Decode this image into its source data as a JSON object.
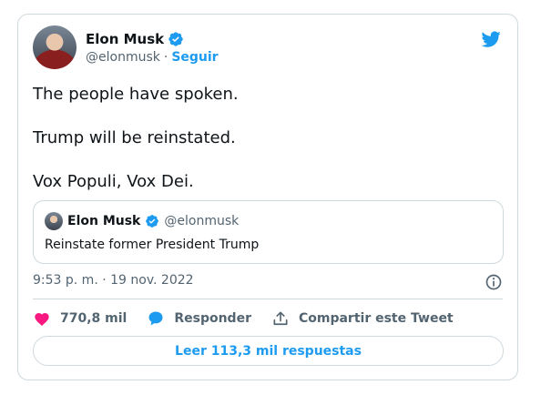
{
  "tweet": {
    "author_name": "Elon Musk",
    "author_handle": "@elonmusk",
    "separator": "·",
    "follow_label": "Seguir",
    "text_lines": [
      "The people have spoken.",
      "Trump will be reinstated.",
      "Vox Populi, Vox Dei."
    ],
    "timestamp": "9:53 p. m. · 19 nov. 2022"
  },
  "quoted": {
    "author_name": "Elon Musk",
    "author_handle": "@elonmusk",
    "text": "Reinstate former President Trump"
  },
  "actions": {
    "like_count": "770,8 mil",
    "reply_label": "Responder",
    "share_label": "Compartir este Tweet"
  },
  "replies_button": "Leer 113,3 mil respuestas",
  "colors": {
    "brand_blue": "#1d9bf0",
    "like_pink": "#f91880",
    "text": "#0f1419",
    "muted": "#536471",
    "border": "#cfd9de"
  },
  "icons": [
    "verified-badge-icon",
    "twitter-bird-icon",
    "info-icon",
    "heart-icon",
    "reply-bubble-icon",
    "share-icon"
  ]
}
